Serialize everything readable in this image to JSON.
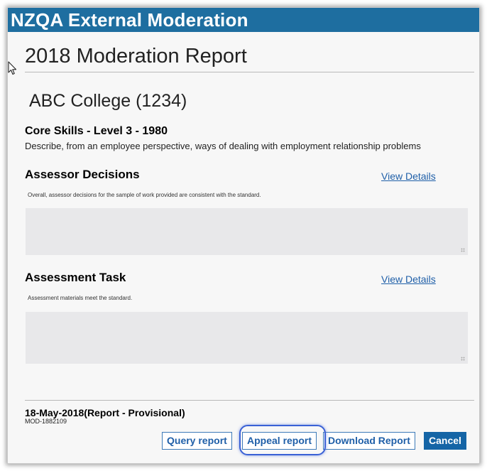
{
  "window": {
    "title": "NZQA External Moderation"
  },
  "report": {
    "title": "2018 Moderation Report",
    "organisation": "ABC College (1234)",
    "standard_title": "Core Skills - Level 3 - 1980",
    "standard_description": "Describe, from an employee perspective, ways of dealing with employment relationship problems"
  },
  "sections": [
    {
      "heading": "Assessor Decisions",
      "link": "View Details",
      "note": "Overall, assessor decisions for the sample of work provided are consistent with the standard.",
      "comment_value": ""
    },
    {
      "heading": "Assessment Task",
      "link": "View Details",
      "note": "Assessment materials meet the standard.",
      "comment_value": ""
    }
  ],
  "footer": {
    "date_status": "18-May-2018(Report - Provisional)",
    "moderation_id": "MOD-1882109"
  },
  "buttons": {
    "query": "Query report",
    "appeal": "Appeal report",
    "download": "Download Report",
    "cancel": "Cancel"
  },
  "colors": {
    "titlebar": "#1e6ea0",
    "link": "#1f5fa8",
    "primary_button": "#1565a6",
    "highlight_ring": "#3a61d6"
  },
  "icons": {
    "cursor": "mouse-pointer-icon",
    "resize": "resize-grip-icon"
  }
}
